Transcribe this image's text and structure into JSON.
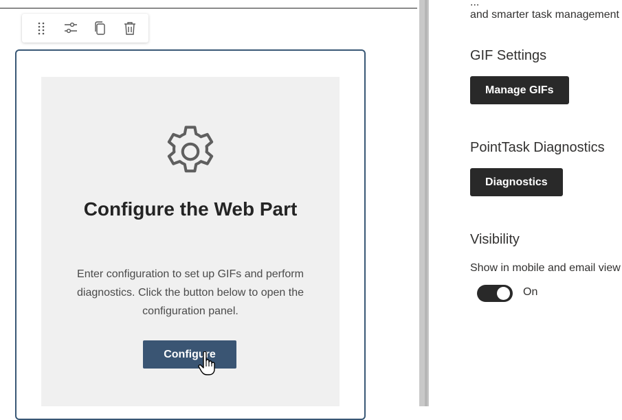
{
  "toolbar": {
    "icons": [
      "drag-handle-icon",
      "settings-sliders-icon",
      "duplicate-icon",
      "delete-icon"
    ]
  },
  "placeholder": {
    "icon": "gear-icon",
    "title": "Configure the Web Part",
    "description": "Enter configuration to set up GIFs and perform diagnostics. Click the button below to open the configuration panel.",
    "button_label": "Configure"
  },
  "panel": {
    "intro_line1": "...",
    "intro_line2": "and smarter task management",
    "gif_section_title": "GIF Settings",
    "gif_button_label": "Manage GIFs",
    "diag_section_title": "PointTask Diagnostics",
    "diag_button_label": "Diagnostics",
    "visibility_title": "Visibility",
    "visibility_desc": "Show in mobile and email view",
    "toggle_state_label": "On",
    "toggle_on": true
  },
  "colors": {
    "frame_border": "#385775",
    "configure_button": "#3a5573",
    "dark_button": "#292929",
    "placeholder_bg": "#f0f0f0"
  }
}
